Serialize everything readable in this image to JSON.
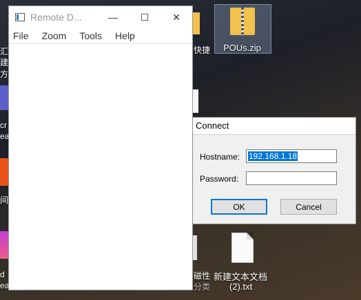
{
  "window": {
    "title": "Remote D...",
    "minimize": "—",
    "maximize": "☐",
    "close": "✕",
    "menu": [
      "File",
      "Zoom",
      "Tools",
      "Help"
    ]
  },
  "dialog": {
    "title": "Connect",
    "hostname_label": "Hostname:",
    "hostname_value": "192.168.1.18",
    "password_label": "Password:",
    "password_value": "",
    "ok_label": "OK",
    "cancel_label": "Cancel"
  },
  "desktop": {
    "zip_label": "POUs.zip",
    "shortcut_label": "快捷",
    "props_label": "磁性",
    "props_sub": "分类",
    "txt_label_1": "新建文本文档",
    "txt_label_2": "(2).txt",
    "left_labels": [
      "汇",
      "建方",
      "cr",
      "ea",
      "间日",
      "d",
      "eatin"
    ]
  }
}
